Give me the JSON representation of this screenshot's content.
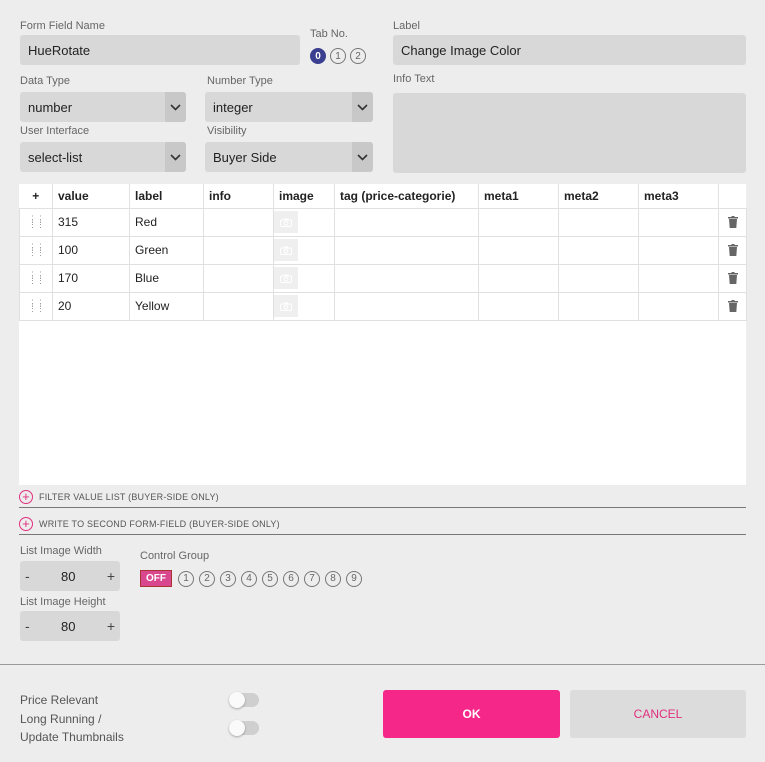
{
  "form": {
    "field_name_label": "Form Field Name",
    "field_name_value": "HueRotate",
    "tab_no_label": "Tab No.",
    "tabs": [
      "0",
      "1",
      "2"
    ],
    "label_label": "Label",
    "label_value": "Change Image Color",
    "data_type_label": "Data Type",
    "data_type_value": "number",
    "number_type_label": "Number Type",
    "number_type_value": "integer",
    "info_text_label": "Info Text",
    "ui_label": "User Interface",
    "ui_value": "select-list",
    "visibility_label": "Visibility",
    "visibility_value": "Buyer Side"
  },
  "table": {
    "headers": [
      "+",
      "value",
      "label",
      "info",
      "image",
      "tag (price-categorie)",
      "meta1",
      "meta2",
      "meta3"
    ],
    "rows": [
      {
        "value": "315",
        "label": "Red"
      },
      {
        "value": "100",
        "label": "Green"
      },
      {
        "value": "170",
        "label": "Blue"
      },
      {
        "value": "20",
        "label": "Yellow"
      }
    ]
  },
  "expanders": {
    "filter": "FILTER VALUE LIST (BUYER-SIDE ONLY)",
    "write": "WRITE TO SECOND FORM-FIELD (BUYER-SIDE ONLY)"
  },
  "image_settings": {
    "width_label": "List Image Width",
    "width_value": "80",
    "height_label": "List Image Height",
    "height_value": "80",
    "minus": "-",
    "plus": "+"
  },
  "control_group": {
    "label": "Control Group",
    "off_label": "OFF",
    "numbers": [
      "1",
      "2",
      "3",
      "4",
      "5",
      "6",
      "7",
      "8",
      "9"
    ]
  },
  "footer": {
    "price_relevant": "Price Relevant",
    "long_running_1": "Long Running /",
    "long_running_2": "Update Thumbnails",
    "ok": "OK",
    "cancel": "CANCEL"
  },
  "colors": {
    "accent": "#f5288a",
    "tab_active": "#3a3f8f"
  }
}
